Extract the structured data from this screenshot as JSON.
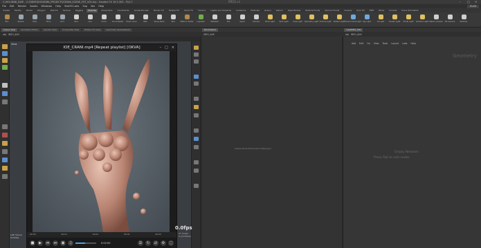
{
  "titlebar": {
    "title": "C:/HOUDINI_DIVE - C:/SIDEFX/HOUDINI_PROJECTS/CRANI_SCENE_FXT_V01.hip - Houdini FX 19.5.303 - Py3.7",
    "watermark": "RRCG.cn"
  },
  "menubar": {
    "items": [
      "File",
      "Edit",
      "Render",
      "Assets",
      "Windows",
      "Help",
      "SideFX Labs",
      "Sop",
      "Vex",
      "Help"
    ],
    "desktop_chip": "Build"
  },
  "shelftabs": {
    "tabs": [
      "Create",
      "Modify",
      "Model",
      "Polygon",
      "Deform",
      "Texture",
      "Rigging",
      "Muscles",
      "Characters",
      "Constraints",
      "Guide Process",
      "Terrain FX",
      "Simple FX",
      "Cloud FX",
      "Volume",
      "Lights and Cameras",
      "Collisions",
      "Particles",
      "Grains",
      "Vellum",
      "Rigid Bodies",
      "Particle Fluids",
      "Viscous Fluids",
      "Oceans",
      "Pyro FX",
      "FEM",
      "Wires",
      "Crowds",
      "Drive Simulation"
    ],
    "active_index": 7
  },
  "shelf": {
    "tools": [
      {
        "label": "Box",
        "icon": "box-icon",
        "color": "#b08850"
      },
      {
        "label": "Sphere",
        "icon": "sphere-icon",
        "color": "#9aa6b0"
      },
      {
        "label": "Tube",
        "icon": "tube-icon",
        "color": "#9aa6b0"
      },
      {
        "label": "Torus",
        "icon": "torus-icon",
        "color": "#9aa6b0"
      },
      {
        "label": "Grid",
        "icon": "grid-icon",
        "color": "#9aa6b0"
      },
      {
        "label": "Null",
        "icon": "null-icon",
        "color": "#cfcfcf"
      },
      {
        "label": "Line",
        "icon": "line-icon",
        "color": "#cfcfcf"
      },
      {
        "label": "Circle",
        "icon": "circle-icon",
        "color": "#cfcfcf"
      },
      {
        "label": "Curve Bezier",
        "icon": "curve-icon",
        "color": "#cfcfcf"
      },
      {
        "label": "Draw Curve",
        "icon": "draw-curve-icon",
        "color": "#cfcfcf"
      },
      {
        "label": "Path",
        "icon": "path-icon",
        "color": "#cfcfcf"
      },
      {
        "label": "Spray Paint",
        "icon": "spray-icon",
        "color": "#cfcfcf"
      },
      {
        "label": "Text",
        "icon": "text-icon",
        "color": "#cfcfcf"
      },
      {
        "label": "Platonic Solids",
        "icon": "platonic-icon",
        "color": "#b08850"
      },
      {
        "label": "L-System",
        "icon": "lsystem-icon",
        "color": "#6fae4a"
      },
      {
        "label": "Metaball",
        "icon": "metaball-icon",
        "color": "#cfcfcf"
      },
      {
        "label": "File",
        "icon": "file-icon",
        "color": "#cfcfcf"
      },
      {
        "label": "Spiral",
        "icon": "spiral-icon",
        "color": "#cfcfcf"
      },
      {
        "label": "Camera",
        "icon": "camera-icon",
        "color": "#cfcfcf"
      },
      {
        "label": "Point Light",
        "icon": "point-light-icon",
        "color": "#e0c060"
      },
      {
        "label": "Spot Light",
        "icon": "spot-light-icon",
        "color": "#e0c060"
      },
      {
        "label": "Area Light",
        "icon": "area-light-icon",
        "color": "#e0c060"
      },
      {
        "label": "Geometry Light",
        "icon": "geo-light-icon",
        "color": "#e0c060"
      },
      {
        "label": "Volume Light",
        "icon": "volume-light-icon",
        "color": "#e0c060"
      },
      {
        "label": "Distant Light",
        "icon": "distant-light-icon",
        "color": "#e0c060"
      },
      {
        "label": "Environment Light",
        "icon": "env-light-icon",
        "color": "#6fa8dc"
      },
      {
        "label": "Sky Light",
        "icon": "sky-light-icon",
        "color": "#6fa8dc"
      },
      {
        "label": "GI Light",
        "icon": "gi-light-icon",
        "color": "#e0c060"
      },
      {
        "label": "Caustic Light",
        "icon": "caustic-light-icon",
        "color": "#e0c060"
      },
      {
        "label": "Portal Light",
        "icon": "portal-light-icon",
        "color": "#e0c060"
      },
      {
        "label": "Ambient Light",
        "icon": "ambient-light-icon",
        "color": "#e0c060"
      },
      {
        "label": "Stereo Camera",
        "icon": "stereo-camera-icon",
        "color": "#cfcfcf"
      },
      {
        "label": "VR Camera",
        "icon": "vr-camera-icon",
        "color": "#cfcfcf"
      },
      {
        "label": "Switcher",
        "icon": "switcher-icon",
        "color": "#cfcfcf"
      }
    ]
  },
  "panetabs_left": {
    "tabs": [
      "Scene View",
      "Animation Editor",
      "Render View",
      "Composite View",
      "Motion FX View",
      "Geometry Spreadsheet"
    ],
    "active_index": 0
  },
  "panetabs_mid": {
    "tabs": [
      "Parameters"
    ],
    "active_index": 0
  },
  "panetabs_right": {
    "tabs": [
      "/obj/IDEO_A00"
    ],
    "active_index": 0
  },
  "pathbar_left": {
    "items": [
      "obj",
      "IDEO_A00"
    ]
  },
  "pathbar_mid": {
    "items": [
      "IDEO_A00"
    ]
  },
  "pathbar_right": {
    "items": [
      "obj",
      "IDEO_A00"
    ]
  },
  "viewport": {
    "label": "View"
  },
  "player": {
    "title": "IOE_CRANI.mp4 [Repeat playlist] [OKVA]",
    "timeline_labels": [
      "00:00",
      "00:01",
      "00:01",
      "00:01",
      "00:02"
    ],
    "time": "0:02:00",
    "volume_fraction": 0.45
  },
  "fps": {
    "value": "0.0fps",
    "line1": "37 draws",
    "line2": "0 primitives"
  },
  "leftinfo": {
    "line1": "Left mouse",
    "line2": "tumbles"
  },
  "midpane": {
    "hint": "Visible Node Parameters Displayed"
  },
  "rightpane": {
    "menus": [
      "Add",
      "Edit",
      "Go",
      "View",
      "Tools",
      "Layout",
      "Labs",
      "Help"
    ],
    "geo_label": "Geometry",
    "empty_line1": "Empty Network",
    "empty_line2": "Press Tab to add nodes"
  }
}
